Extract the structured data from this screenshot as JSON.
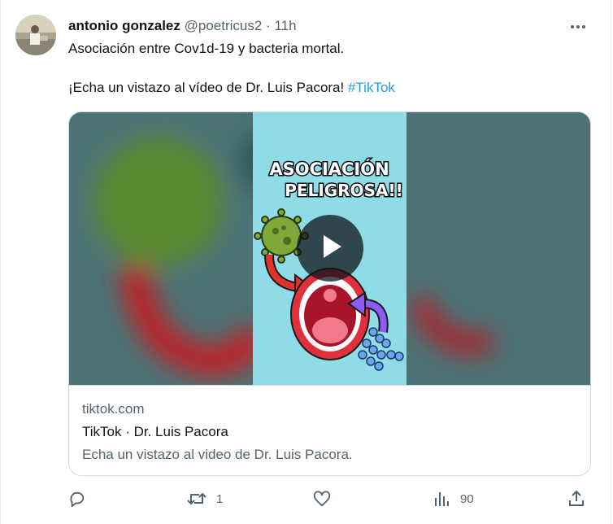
{
  "author": {
    "name": "antonio gonzalez",
    "handle": "@poetricus2",
    "separator": "·",
    "time": "11h"
  },
  "tweet": {
    "line1": "Asociación entre Cov1d-19 y bacteria mortal.",
    "line2_text": "¡Echa un vistazo al vídeo de Dr. Luis Pacora! ",
    "hashtag": "#TikTok"
  },
  "card": {
    "thumbnail_text_line1": "ASOCIACIÓN",
    "thumbnail_text_line2": "PELIGROSA!!",
    "domain": "tiktok.com",
    "title": "TikTok · Dr. Luis Pacora",
    "description": "Echa un vistazo al video de Dr. Luis Pacora."
  },
  "actions": {
    "reply_count": "",
    "retweet_count": "1",
    "like_count": "",
    "views_count": "90"
  },
  "colors": {
    "accent": "#1d9bf0",
    "secondary_text": "#536471",
    "media_bg": "#4c7275",
    "thumbnail_bg": "#8fdce6"
  },
  "icons": [
    "avatar",
    "more-icon",
    "play-icon",
    "reply-icon",
    "retweet-icon",
    "like-icon",
    "views-icon",
    "share-icon"
  ]
}
